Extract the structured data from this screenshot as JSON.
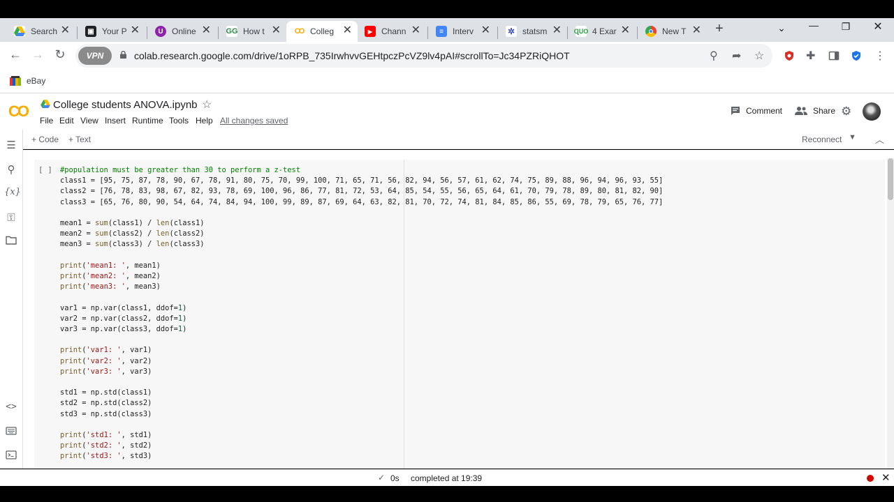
{
  "browser": {
    "tabs": [
      {
        "title": "Search",
        "icon": "google-drive-icon",
        "color": "#4285f4"
      },
      {
        "title": "Your P",
        "icon": "dark-app-icon",
        "color": "#202124"
      },
      {
        "title": "Online",
        "icon": "purple-circle-icon",
        "color": "#8e24aa"
      },
      {
        "title": "How t",
        "icon": "geeks-icon",
        "color": "#2f8d46"
      },
      {
        "title": "Colleg",
        "icon": "colab-icon",
        "color": "#f9ab00"
      },
      {
        "title": "Chann",
        "icon": "youtube-icon",
        "color": "#ff0000"
      },
      {
        "title": "Interv",
        "icon": "docs-icon",
        "color": "#4285f4"
      },
      {
        "title": "statsm",
        "icon": "statsmodels-icon",
        "color": "#3f51b5"
      },
      {
        "title": "4 Exar",
        "icon": "quizlet-icon",
        "color": "#25a244"
      },
      {
        "title": "New T",
        "icon": "chrome-icon",
        "color": "#ea4335"
      }
    ],
    "active_tab": 4,
    "url": "colab.research.google.com/drive/1oRPB_735IrwhvvGEHtpczPcVZ9lv4pAI#scrollTo=Jc34PZRiQHOT",
    "vpn_label": "VPN",
    "bookmark": "eBay"
  },
  "colab": {
    "logo": "CO",
    "notebook_title": "College students ANOVA.ipynb",
    "menu": [
      "File",
      "Edit",
      "View",
      "Insert",
      "Runtime",
      "Tools",
      "Help"
    ],
    "save_status": "All changes saved",
    "comment_label": "Comment",
    "share_label": "Share",
    "add_code_label": "+ Code",
    "add_text_label": "+ Text",
    "reconnect_label": "Reconnect",
    "run_indicator": "[ ]"
  },
  "code": {
    "comment": "#population must be greater than 30 to perform a z-test",
    "class1": "[95, 75, 87, 78, 90, 67, 78, 91, 80, 75, 70, 99, 100, 71, 65, 71, 56, 82, 94, 56, 57, 61, 62, 74, 75, 89, 88, 96, 94, 96, 93, 55]",
    "class2": "[76, 78, 83, 98, 67, 82, 93, 78, 69, 100, 96, 86, 77, 81, 72, 53, 64, 85, 54, 55, 56, 65, 64, 61, 70, 79, 78, 89, 80, 81, 82, 90]",
    "class3": "[65, 76, 80, 90, 54, 64, 74, 84, 94, 100, 99, 89, 87, 69, 64, 63, 82, 81, 70, 72, 74, 81, 84, 85, 86, 55, 69, 78, 79, 65, 76, 77]"
  },
  "status": {
    "exec_time": "0s",
    "completed": "completed at 19:39"
  },
  "colors": {
    "accent_orange": "#f9ab00",
    "comment_green": "#008000",
    "string_red": "#a31515"
  }
}
